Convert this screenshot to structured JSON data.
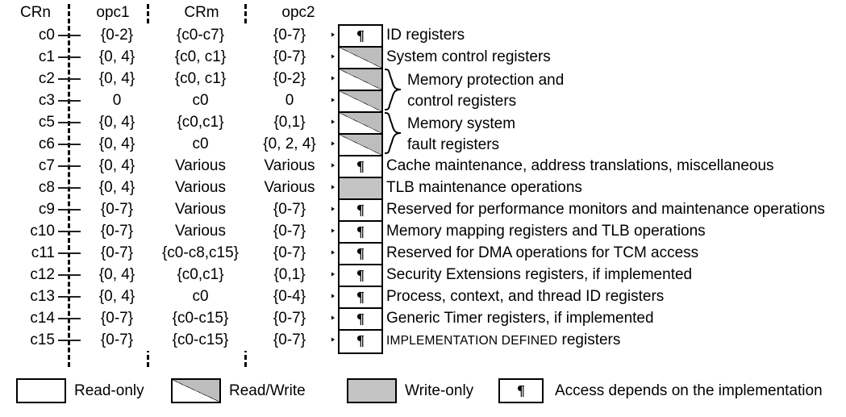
{
  "headers": [
    {
      "label": "CRn"
    },
    {
      "label": "opc1"
    },
    {
      "label": "CRm"
    },
    {
      "label": "opc2"
    }
  ],
  "legend_title": "",
  "rows": [
    {
      "crn": "c0",
      "opc1": "{0-2}",
      "crm": "{c0-c7}",
      "opc2": "{0-7}",
      "access": "impl",
      "glyph": "¶",
      "desc": "ID registers"
    },
    {
      "crn": "c1",
      "opc1": "{0, 4}",
      "crm": "{c0, c1}",
      "opc2": "{0-7}",
      "access": "rw",
      "glyph": "",
      "desc": "System control registers"
    },
    {
      "crn": "c2",
      "opc1": "{0, 4}",
      "crm": "{c0, c1}",
      "opc2": "{0-2}",
      "access": "rw",
      "glyph": "",
      "desc": ""
    },
    {
      "crn": "c3",
      "opc1": "0",
      "crm": "c0",
      "opc2": "0",
      "access": "rw",
      "glyph": "",
      "desc": ""
    },
    {
      "crn": "c5",
      "opc1": "{0, 4}",
      "crm": "{c0,c1}",
      "opc2": "{0,1}",
      "access": "rw",
      "glyph": "",
      "desc": ""
    },
    {
      "crn": "c6",
      "opc1": "{0, 4}",
      "crm": "c0",
      "opc2": "{0, 2, 4}",
      "access": "rw",
      "glyph": "",
      "desc": ""
    },
    {
      "crn": "c7",
      "opc1": "{0, 4}",
      "crm": "Various",
      "opc2": "Various",
      "access": "impl",
      "glyph": "¶",
      "desc": "Cache maintenance, address translations, miscellaneous"
    },
    {
      "crn": "c8",
      "opc1": "{0, 4}",
      "crm": "Various",
      "opc2": "Various",
      "access": "wo",
      "glyph": "",
      "desc": "TLB maintenance operations"
    },
    {
      "crn": "c9",
      "opc1": "{0-7}",
      "crm": "Various",
      "opc2": "{0-7}",
      "access": "impl",
      "glyph": "¶",
      "desc": "Reserved for performance monitors and maintenance operations"
    },
    {
      "crn": "c10",
      "opc1": "{0-7}",
      "crm": "Various",
      "opc2": "{0-7}",
      "access": "impl",
      "glyph": "¶",
      "desc": "Memory mapping registers and TLB operations"
    },
    {
      "crn": "c11",
      "opc1": "{0-7}",
      "crm": "{c0-c8,c15}",
      "opc2": "{0-7}",
      "access": "impl",
      "glyph": "¶",
      "desc": "Reserved for DMA operations for TCM access"
    },
    {
      "crn": "c12",
      "opc1": "{0, 4}",
      "crm": "{c0,c1}",
      "opc2": "{0,1}",
      "access": "impl",
      "glyph": "¶",
      "desc": "Security Extensions registers, if implemented"
    },
    {
      "crn": "c13",
      "opc1": "{0, 4}",
      "crm": "c0",
      "opc2": "{0-4}",
      "access": "impl",
      "glyph": "¶",
      "desc": "Process, context, and thread ID registers"
    },
    {
      "crn": "c14",
      "opc1": "{0-7}",
      "crm": "{c0-c15}",
      "opc2": "{0-7}",
      "access": "impl",
      "glyph": "¶",
      "desc": "Generic Timer registers, if implemented"
    },
    {
      "crn": "c15",
      "opc1": "{0-7}",
      "crm": "{c0-c15}",
      "opc2": "{0-7}",
      "access": "impl",
      "glyph": "¶",
      "desc": "IMPLEMENTATION DEFINED registers",
      "desc_smallcaps": "IMPLEMENTATION DEFINED",
      "desc_rest": " registers"
    }
  ],
  "groups": [
    {
      "line1": "Memory protection and",
      "line2": "control registers"
    },
    {
      "line1": "Memory system",
      "line2": "fault registers"
    }
  ],
  "legend": [
    {
      "swatch": "ro",
      "glyph": "",
      "label": "Read-only"
    },
    {
      "swatch": "rw",
      "glyph": "",
      "label": "Read/Write"
    },
    {
      "swatch": "wo",
      "glyph": "",
      "label": "Write-only"
    },
    {
      "swatch": "impl",
      "glyph": "¶",
      "label": "Access depends on the implementation"
    }
  ],
  "colors": {
    "gray_fill": "#bdbdbd",
    "write_only_fill": "#c4c4c4",
    "line": "#000000",
    "background": "#ffffff"
  }
}
